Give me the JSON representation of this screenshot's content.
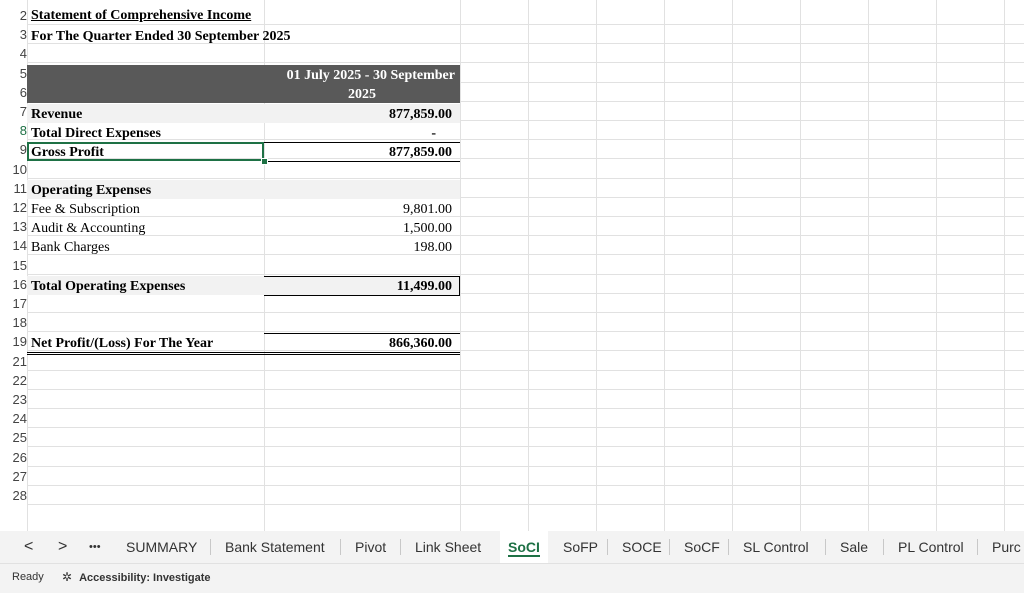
{
  "sheet": {
    "title": "Statement of Comprehensive Income",
    "subtitle": "For The Quarter Ended 30 September 2025",
    "period_header_line1": "01 July 2025 - 30 September",
    "period_header_line2": "2025",
    "rows": {
      "revenue_label": "Revenue",
      "revenue_value": "877,859.00",
      "direct_exp_label": "Total Direct Expenses",
      "direct_exp_value": "-",
      "gross_profit_label": "Gross Profit",
      "gross_profit_value": "877,859.00",
      "opex_header": "Operating Expenses",
      "fee_label": "Fee & Subscription",
      "fee_value": "9,801.00",
      "audit_label": "Audit & Accounting",
      "audit_value": "1,500.00",
      "bank_label": "Bank Charges",
      "bank_value": "198.00",
      "total_opex_label": "Total Operating Expenses",
      "total_opex_value": "11,499.00",
      "net_label": "Net Profit/(Loss) For The Year",
      "net_value": "866,360.00"
    },
    "row_numbers": [
      "2",
      "3",
      "4",
      "5",
      "6",
      "7",
      "8",
      "9",
      "10",
      "11",
      "12",
      "13",
      "14",
      "15",
      "16",
      "17",
      "18",
      "19",
      "21",
      "22",
      "23",
      "24",
      "25",
      "26",
      "27",
      "28"
    ]
  },
  "tabs": {
    "prev": "<",
    "next": ">",
    "more": "•••",
    "items": [
      "SUMMARY",
      "Bank Statement",
      "Pivot",
      "Link Sheet",
      "SoCI",
      "SoFP",
      "SOCE",
      "SoCF",
      "SL Control",
      "Sale",
      "PL Control",
      "Purc"
    ]
  },
  "status": {
    "ready": "Ready",
    "accessibility": "Accessibility: Investigate"
  },
  "colors": {
    "accent": "#1e7145",
    "header_fill": "#595959",
    "shade": "#f2f2f2"
  }
}
